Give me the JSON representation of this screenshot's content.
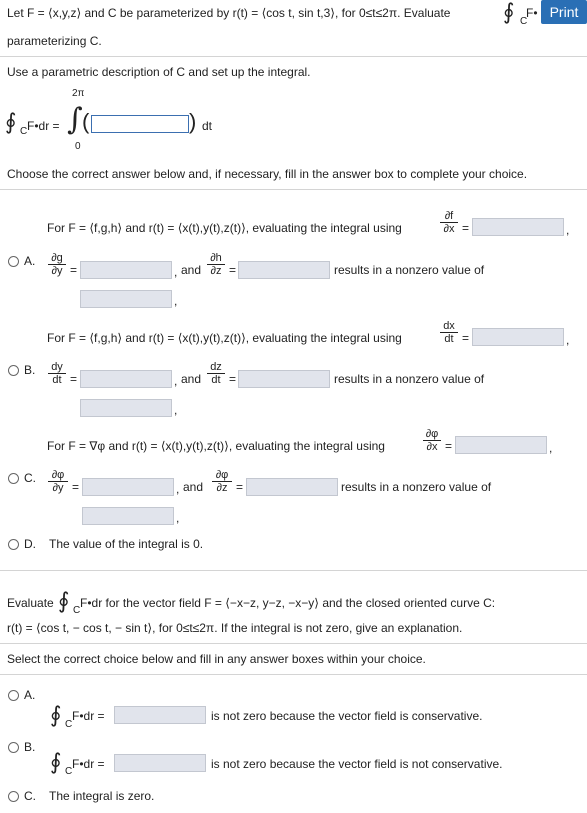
{
  "header": {
    "intro_text": "Let F = ⟨x,y,z⟩ and C be parameterized by r(t) = ⟨cos t, sin t,3⟩, for 0≤t≤2π. Evaluate",
    "intro_tail": "F•",
    "intro_line2": "parameterizing C.",
    "print_label": "Print"
  },
  "part1": {
    "instruction": "Use a parametric description of C and set up the integral.",
    "integral_lhs": "F•dr =",
    "upper_limit": "2π",
    "lower_limit": "0",
    "integrand_value": "",
    "dt_label": "dt",
    "sub_c": "C",
    "choose_text": "Choose the correct answer below and, if necessary, fill in the answer box to complete your choice."
  },
  "optA": {
    "letter": "A.",
    "line1": "For F = ⟨f,g,h⟩ and r(t) = ⟨x(t),y(t),z(t)⟩, evaluating the integral using",
    "frac_top_n": "∂f",
    "frac_top_d": "∂x",
    "frac1_n": "∂g",
    "frac1_d": "∂y",
    "frac2_n": "∂h",
    "frac2_d": "∂z",
    "and_text": "and",
    "result": "results in a nonzero value of",
    "eq": "=",
    "comma": ",",
    "comma2": ","
  },
  "optB": {
    "letter": "B.",
    "line1": "For F = ⟨f,g,h⟩ and r(t) = ⟨x(t),y(t),z(t)⟩, evaluating the integral using",
    "frac_top_n": "dx",
    "frac_top_d": "dt",
    "frac1_n": "dy",
    "frac1_d": "dt",
    "frac2_n": "dz",
    "frac2_d": "dt",
    "and_text": "and",
    "result": "results in a nonzero value of",
    "eq": "=",
    "comma": ",",
    "comma2": ","
  },
  "optC": {
    "letter": "C.",
    "line1": "For F = ∇φ and r(t) = ⟨x(t),y(t),z(t)⟩, evaluating the integral using",
    "frac_top_n": "∂φ",
    "frac_top_d": "∂x",
    "frac1_n": "∂φ",
    "frac1_d": "∂y",
    "frac2_n": "∂φ",
    "frac2_d": "∂z",
    "and_text": "and",
    "result": "results in a nonzero value of",
    "eq": "=",
    "comma": ",",
    "comma2": ","
  },
  "optD": {
    "letter": "D.",
    "text": "The value of the integral is 0."
  },
  "part2": {
    "evaluate_text": "Evaluate",
    "evaluate_tail": "F•dr for the vector field F = ⟨−x−z, y−z, −x−y⟩ and the closed oriented curve C:",
    "line2": "r(t) = ⟨cos t, − cos t, − sin t⟩, for 0≤t≤2π. If the integral is not zero, give an explanation.",
    "select_text": "Select the correct choice below and fill in any answer boxes within your choice.",
    "sub_c": "C",
    "a_letter": "A.",
    "a_lhs": "F•dr =",
    "a_text": "is not zero because the vector field is conservative.",
    "b_letter": "B.",
    "b_lhs": "F•dr =",
    "b_text": "is not zero because the vector field is not conservative.",
    "c_letter": "C.",
    "c_text": "The integral is zero."
  }
}
